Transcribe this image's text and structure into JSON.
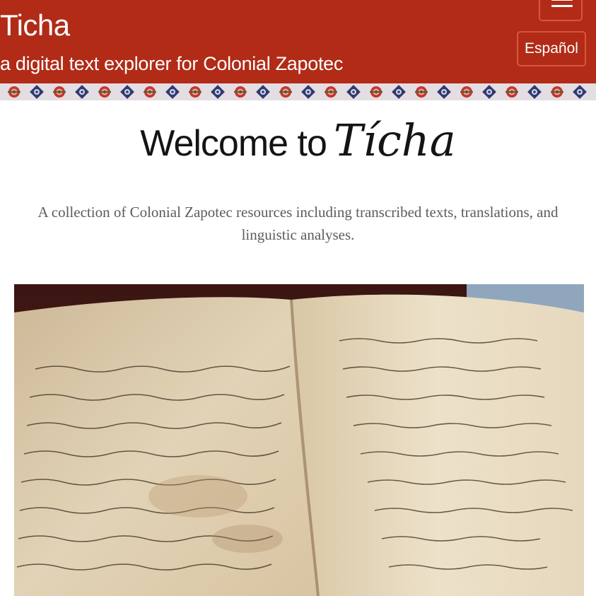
{
  "header": {
    "title": "Ticha",
    "tagline": "a digital text explorer for Colonial Zapotec",
    "language_button": "Español",
    "menu_icon": "hamburger-menu-icon",
    "background_color": "#b12b17"
  },
  "main": {
    "heading_prefix": "Welcome to",
    "heading_brand": "Tícha",
    "description": "A collection of Colonial Zapotec resources including transcribed texts, translations, and linguistic analyses."
  },
  "hero_image": {
    "subject": "manuscript-photo"
  }
}
